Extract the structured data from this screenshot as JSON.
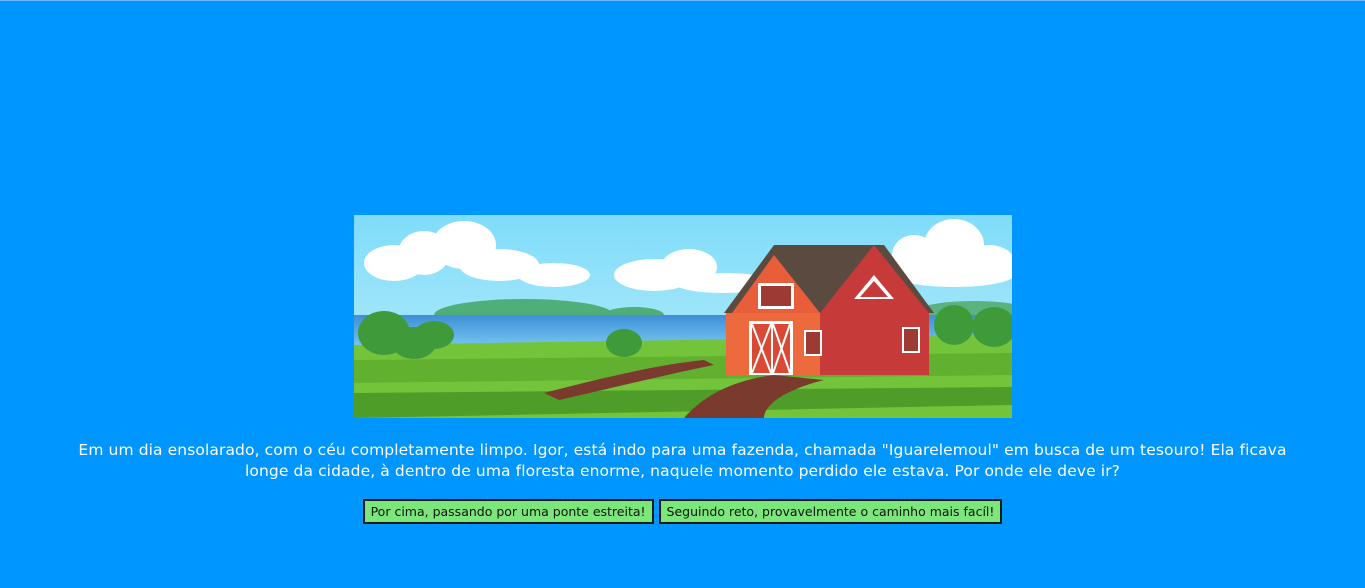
{
  "story": {
    "text": "Em um dia ensolarado, com o céu completamente limpo. Igor, está indo para uma fazenda, chamada \"Iguarelemoul\" em busca de um tesouro! Ela ficava longe da cidade, à dentro de uma floresta enorme, naquele momento perdido ele estava. Por onde ele deve ir?"
  },
  "choices": {
    "option_1": "Por cima, passando por uma ponte estreita!",
    "option_2": "Seguindo reto, provavelmente o caminho mais facíl!"
  },
  "colors": {
    "background": "#0096ff",
    "button": "#7be77b",
    "text": "#ffffff"
  }
}
